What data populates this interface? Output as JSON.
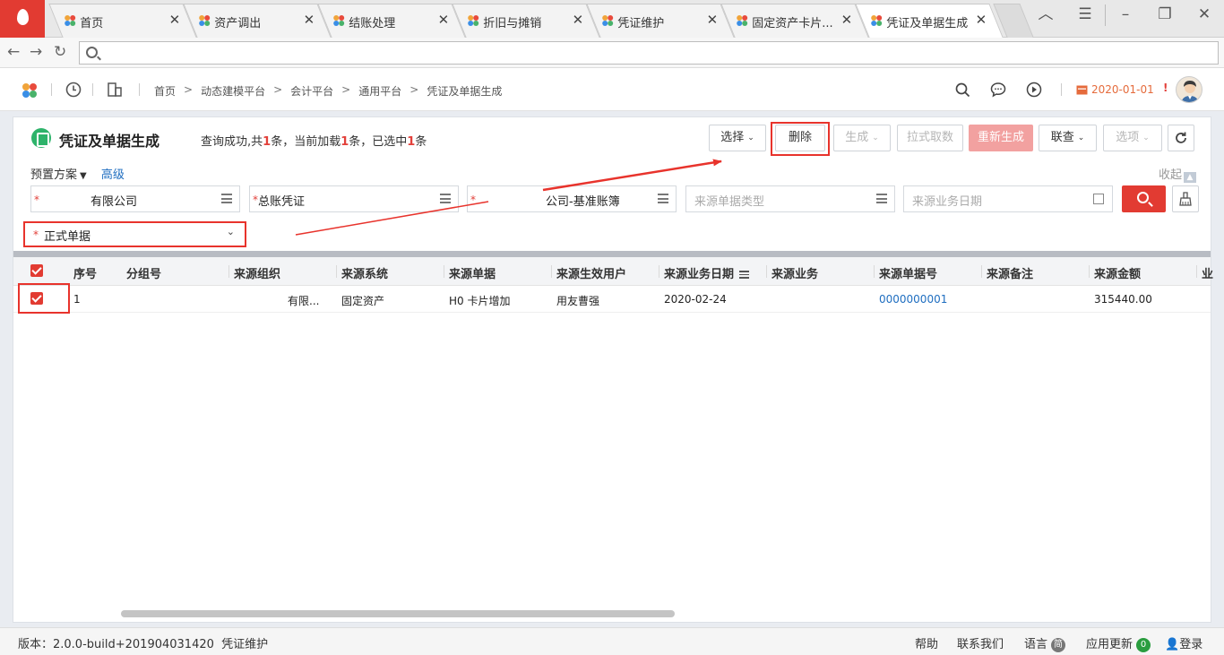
{
  "browser": {
    "tabs": [
      {
        "label": "首页"
      },
      {
        "label": "资产调出"
      },
      {
        "label": "结账处理"
      },
      {
        "label": "折旧与摊销"
      },
      {
        "label": "凭证维护"
      },
      {
        "label": "固定资产卡片..."
      },
      {
        "label": "凭证及单据生成"
      }
    ],
    "close_glyph": "✕"
  },
  "header": {
    "breadcrumbs": [
      "首页",
      "动态建模平台",
      "会计平台",
      "通用平台",
      "凭证及单据生成"
    ],
    "crumb_sep": ">",
    "date": "2020-01-01",
    "alert_glyph": "!"
  },
  "panel": {
    "title": "凭证及单据生成",
    "status": {
      "prefix": "查询成功,共",
      "total": "1",
      "mid1": "条，当前加载",
      "loaded": "1",
      "mid2": "条，已选中",
      "selected": "1",
      "suffix": "条"
    },
    "buttons": {
      "select": "选择",
      "delete": "删除",
      "generate": "生成",
      "pull": "拉式取数",
      "regenerate": "重新生成",
      "linkquery": "联查",
      "options": "选项"
    },
    "preset_label": "预置方案",
    "advanced_label": "高级",
    "collapse_label": "收起",
    "filters": {
      "org": "有限公司",
      "voucher_type": "总账凭证",
      "book": "公司-基准账簿",
      "src_doc_type_placeholder": "来源单据类型",
      "src_date_placeholder": "来源业务日期",
      "doc_kind": "正式单据"
    }
  },
  "table": {
    "columns": [
      "序号",
      "分组号",
      "来源组织",
      "来源系统",
      "来源单据",
      "来源生效用户",
      "来源业务日期",
      "来源业务",
      "来源单据号",
      "来源备注",
      "来源金额",
      "业"
    ],
    "rows": [
      {
        "seq": "1",
        "group": "",
        "org": "有限...",
        "system": "固定资产",
        "doc": "H0 卡片增加",
        "user": "用友曹强",
        "date": "2020-02-24",
        "biz": "",
        "docno": "0000000001",
        "remark": "",
        "amount": "315440.00"
      }
    ]
  },
  "statusbar": {
    "version": "版本：2.0.0-build+201904031420",
    "module": "凭证维护",
    "help": "帮助",
    "contact": "联系我们",
    "lang": "语言",
    "lang_badge": "简",
    "update": "应用更新",
    "update_count": "0",
    "login": "登录"
  },
  "colors": {
    "accent": "#e23b32",
    "link": "#1f6ec0",
    "date": "#e56b3c",
    "annotation": "#e8332c"
  }
}
